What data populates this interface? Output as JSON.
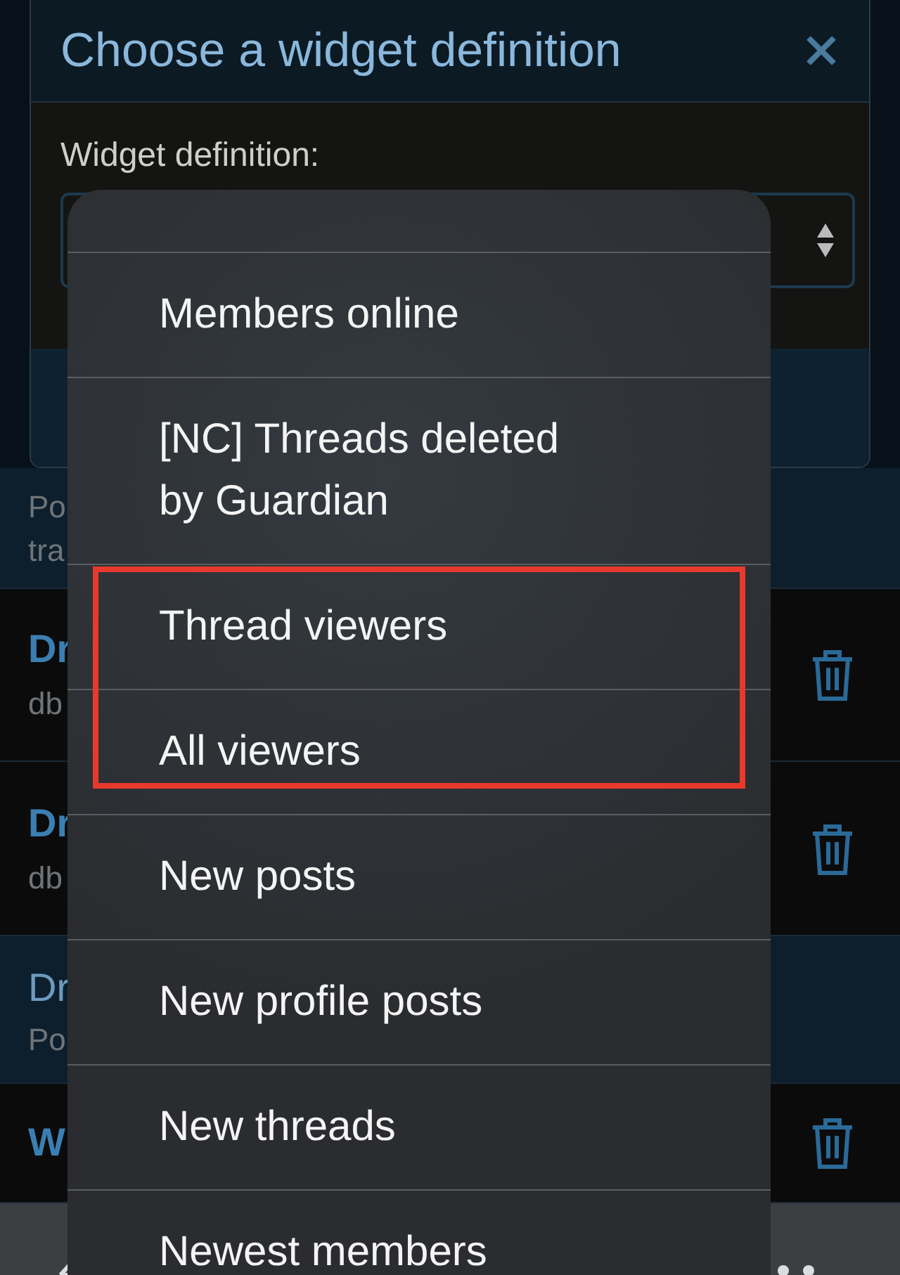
{
  "dialog": {
    "title": "Choose a widget definition",
    "field_label": "Widget definition:"
  },
  "background_rows": [
    {
      "kind": "info",
      "lines": [
        "Po",
        "tra"
      ]
    },
    {
      "kind": "item",
      "title": "Dr",
      "subtitle": "db"
    },
    {
      "kind": "item",
      "title": "Dr",
      "subtitle": "db"
    },
    {
      "kind": "info",
      "lines": [
        "Dr",
        "Po"
      ]
    },
    {
      "kind": "item",
      "title": "W"
    }
  ],
  "menu": {
    "options": [
      {
        "label": "Members online",
        "highlighted": false
      },
      {
        "label": "[NC] Threads deleted by Guardian",
        "highlighted": false
      },
      {
        "label": "Thread viewers",
        "highlighted": true
      },
      {
        "label": "All viewers",
        "highlighted": true
      },
      {
        "label": "New posts",
        "highlighted": false
      },
      {
        "label": "New profile posts",
        "highlighted": false
      },
      {
        "label": "New threads",
        "highlighted": false
      },
      {
        "label": "Newest members",
        "highlighted": false
      }
    ]
  }
}
